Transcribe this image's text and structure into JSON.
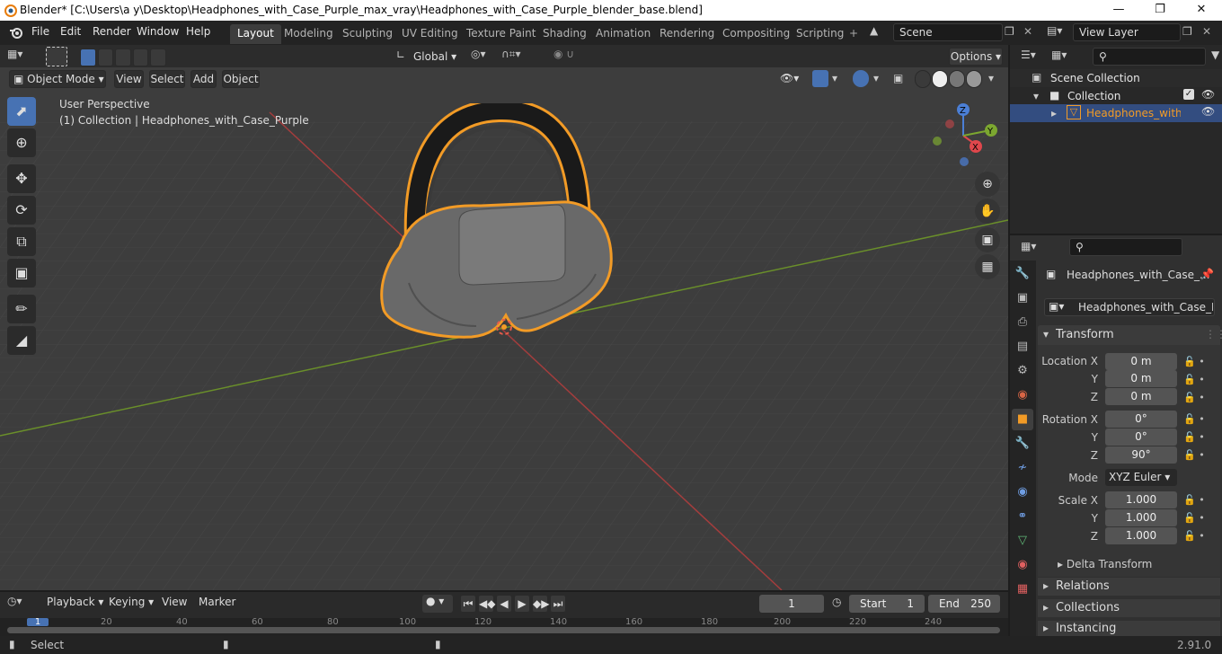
{
  "window": {
    "title": "Blender* [C:\\Users\\a y\\Desktop\\Headphones_with_Case_Purple_max_vray\\Headphones_with_Case_Purple_blender_base.blend]"
  },
  "menu": [
    "File",
    "Edit",
    "Render",
    "Window",
    "Help"
  ],
  "workspaces": [
    "Layout",
    "Modeling",
    "Sculpting",
    "UV Editing",
    "Texture Paint",
    "Shading",
    "Animation",
    "Rendering",
    "Compositing",
    "Scripting"
  ],
  "scene": {
    "name": "Scene",
    "view_layer": "View Layer"
  },
  "header": {
    "transform_orientation": "Global",
    "options": "Options"
  },
  "viewport_header": {
    "mode": "Object Mode",
    "menus": [
      "View",
      "Select",
      "Add",
      "Object"
    ]
  },
  "viewport": {
    "perspective": "User Perspective",
    "context": "(1) Collection | Headphones_with_Case_Purple"
  },
  "gizmo": {
    "x": "X",
    "y": "Y",
    "z": "Z"
  },
  "outliner": {
    "scene_collection": "Scene Collection",
    "collection": "Collection",
    "object": "Headphones_with_Ca"
  },
  "properties": {
    "object_name": "Headphones_with_Case_...",
    "data_name": "Headphones_with_Case_Pur...",
    "transform_title": "Transform",
    "location_label": "Location X",
    "rotation_label": "Rotation X",
    "scale_label": "Scale X",
    "axis_y": "Y",
    "axis_z": "Z",
    "location": [
      "0 m",
      "0 m",
      "0 m"
    ],
    "rotation": [
      "0°",
      "0°",
      "90°"
    ],
    "mode_label": "Mode",
    "mode": "XYZ Euler",
    "scale": [
      "1.000",
      "1.000",
      "1.000"
    ],
    "delta": "Delta Transform",
    "sections": [
      "Relations",
      "Collections",
      "Instancing"
    ]
  },
  "timeline": {
    "menus": [
      "Playback",
      "Keying",
      "View",
      "Marker"
    ],
    "current_frame": "1",
    "start_label": "Start",
    "start": "1",
    "end_label": "End",
    "end": "250",
    "ruler": [
      "1",
      "20",
      "40",
      "60",
      "80",
      "100",
      "120",
      "140",
      "160",
      "180",
      "200",
      "220",
      "240"
    ]
  },
  "status": {
    "left": "Select",
    "version": "2.91.0"
  },
  "colors": {
    "accent": "#4772b3",
    "selection": "#f29b26",
    "x_axis": "#a33d3d",
    "y_axis": "#6a8f2a"
  }
}
